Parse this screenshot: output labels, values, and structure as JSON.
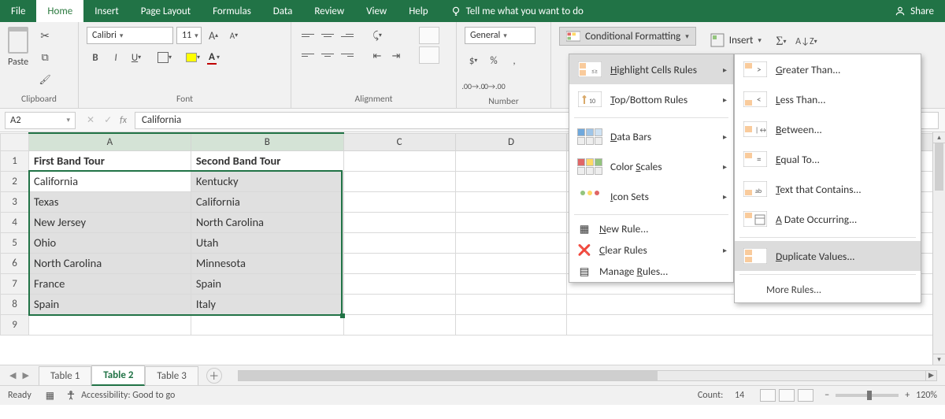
{
  "menubar": {
    "items": [
      "File",
      "Home",
      "Insert",
      "Page Layout",
      "Formulas",
      "Data",
      "Review",
      "View",
      "Help"
    ],
    "active": "Home",
    "tellme": "Tell me what you want to do",
    "share": "Share"
  },
  "ribbon": {
    "clipboard": {
      "paste": "Paste",
      "label": "Clipboard"
    },
    "font": {
      "name": "Calibri",
      "size": "11",
      "label": "Font"
    },
    "alignment": {
      "label": "Alignment"
    },
    "number": {
      "format": "General",
      "label": "Number"
    },
    "cf_button": "Conditional Formatting",
    "insert": "Insert"
  },
  "formula_bar": {
    "cellref": "A2",
    "value": "California"
  },
  "columns": [
    "A",
    "B",
    "C",
    "D"
  ],
  "grid": {
    "headers": [
      "First Band Tour",
      "Second Band Tour"
    ],
    "rows": [
      [
        "California",
        "Kentucky"
      ],
      [
        "Texas",
        "California"
      ],
      [
        "New Jersey",
        "North Carolina"
      ],
      [
        "Ohio",
        "Utah"
      ],
      [
        "North Carolina",
        "Minnesota"
      ],
      [
        "France",
        "Spain"
      ],
      [
        "Spain",
        "Italy"
      ]
    ]
  },
  "tabs": {
    "items": [
      "Table 1",
      "Table 2",
      "Table 3"
    ],
    "active": "Table 2"
  },
  "status": {
    "ready": "Ready",
    "accessibility": "Accessibility: Good to go",
    "count_label": "Count:",
    "count_value": "14",
    "zoom": "120%"
  },
  "cf_menu": {
    "items": [
      {
        "label": "Highlight Cells Rules",
        "u": "H",
        "sub": true,
        "hover": true
      },
      {
        "label": "Top/Bottom Rules",
        "u": "T",
        "sub": true
      },
      {
        "label": "Data Bars",
        "u": "D",
        "sub": true
      },
      {
        "label": "Color Scales",
        "u": "S",
        "sub": true
      },
      {
        "label": "Icon Sets",
        "u": "I",
        "sub": true
      }
    ],
    "rules": [
      {
        "label": "New Rule...",
        "u": "N"
      },
      {
        "label": "Clear Rules",
        "u": "C",
        "sub": true
      },
      {
        "label": "Manage Rules...",
        "u": "R"
      }
    ]
  },
  "hcr_submenu": {
    "items": [
      {
        "label": "Greater Than...",
        "u": "G"
      },
      {
        "label": "Less Than...",
        "u": "L"
      },
      {
        "label": "Between...",
        "u": "B"
      },
      {
        "label": "Equal To...",
        "u": "E"
      },
      {
        "label": "Text that Contains...",
        "u": "T"
      },
      {
        "label": "A Date Occurring...",
        "u": "A"
      },
      {
        "label": "Duplicate Values...",
        "u": "D",
        "hover": true
      }
    ],
    "more": "More Rules..."
  }
}
